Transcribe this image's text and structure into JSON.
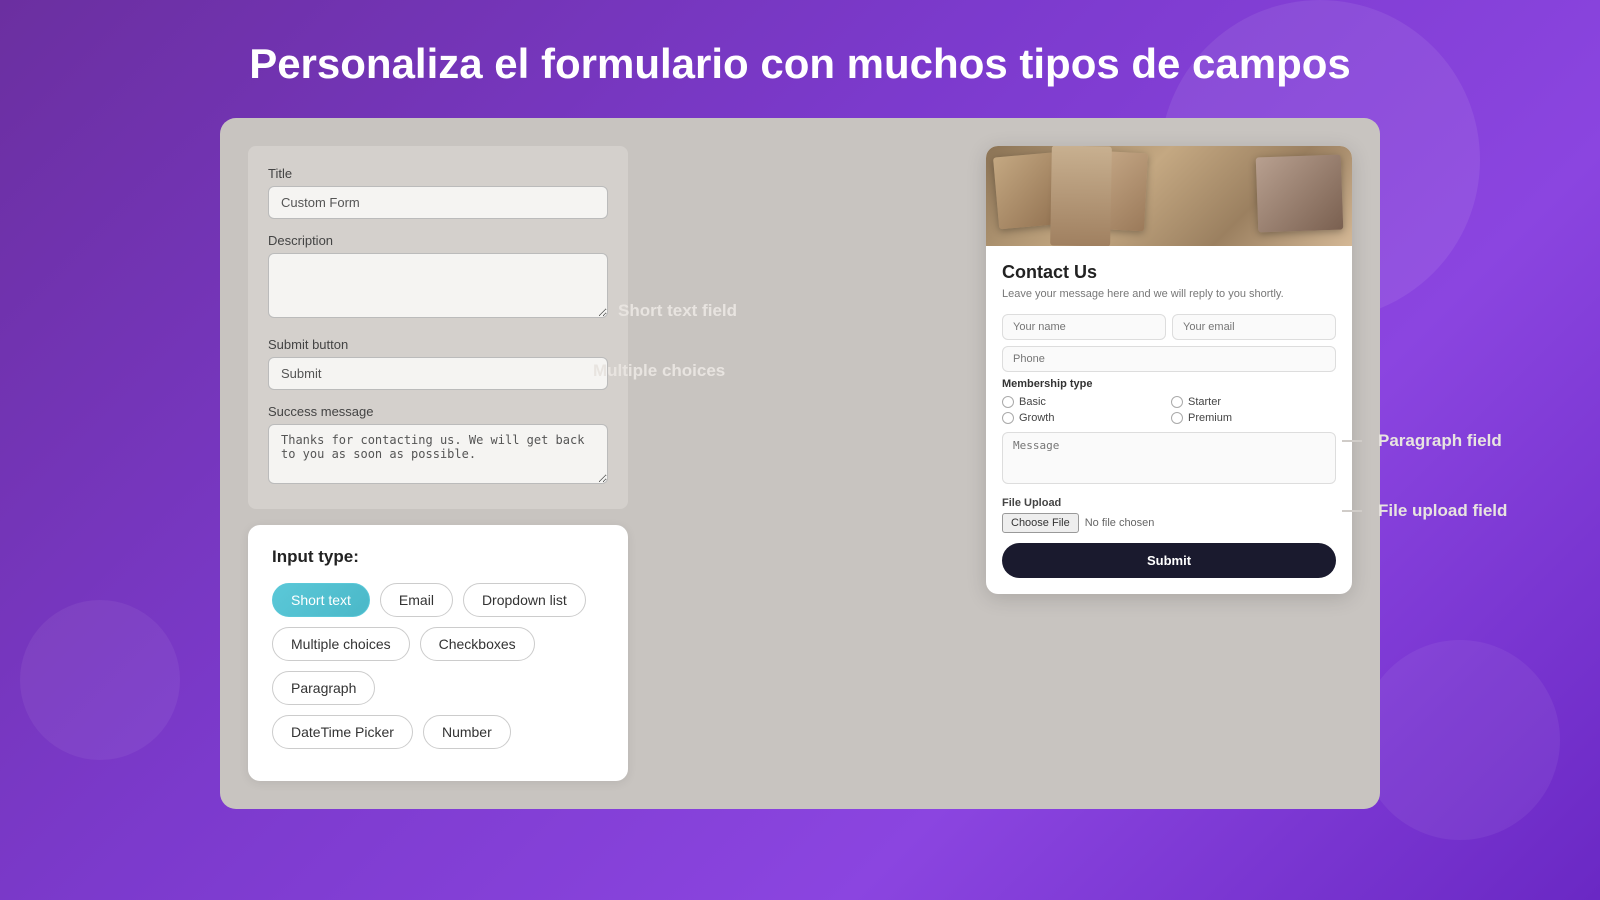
{
  "page": {
    "title": "Personaliza el formulario con muchos tipos de campos",
    "background_gradient_start": "#6b2fa0",
    "background_gradient_end": "#8b45e0"
  },
  "form_settings": {
    "title_label": "Title",
    "title_value": "Custom Form",
    "description_label": "Description",
    "description_value": "",
    "submit_button_label": "Submit button",
    "submit_button_value": "Submit",
    "success_message_label": "Success message",
    "success_message_value": "Thanks for contacting us. We will get back to you as soon as possible."
  },
  "input_type_box": {
    "title": "Input type:",
    "buttons": [
      {
        "label": "Short text",
        "active": true
      },
      {
        "label": "Email",
        "active": false
      },
      {
        "label": "Dropdown list",
        "active": false
      },
      {
        "label": "Multiple choices",
        "active": false
      },
      {
        "label": "Checkboxes",
        "active": false
      },
      {
        "label": "Paragraph",
        "active": false
      },
      {
        "label": "DateTime Picker",
        "active": false
      },
      {
        "label": "Number",
        "active": false
      }
    ]
  },
  "annotations": {
    "short_text_field": "Short text field",
    "multiple_choices": "Multiple choices",
    "paragraph_field": "Paragraph field",
    "file_upload_field": "File upload field"
  },
  "contact_form": {
    "title": "Contact Us",
    "description": "Leave your message here and we will reply to you shortly.",
    "fields": {
      "your_name_placeholder": "Your name",
      "your_email_placeholder": "Your email",
      "phone_placeholder": "Phone",
      "message_placeholder": "Message"
    },
    "membership_label": "Membership type",
    "membership_options": [
      "Basic",
      "Starter",
      "Growth",
      "Premium"
    ],
    "file_upload_label": "File Upload",
    "choose_file_text": "Choose File",
    "no_file_text": "No file chosen",
    "submit_label": "Submit"
  }
}
